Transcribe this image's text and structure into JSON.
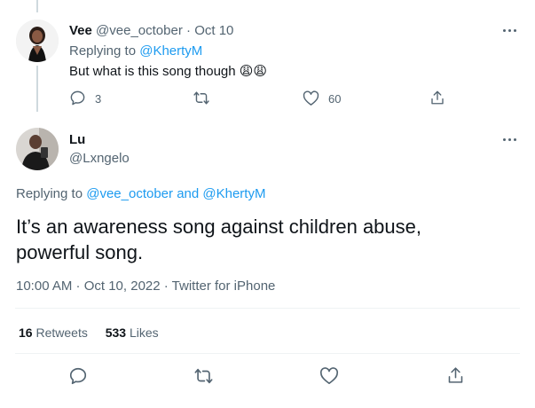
{
  "reply": {
    "display_name": "Vee",
    "handle": "@vee_october",
    "separator": "·",
    "date": "Oct 10",
    "replying_prefix": "Replying to",
    "replying_to": "@KhertyM",
    "text": "But what is this song though",
    "emoji": "😩😩",
    "reply_count": "3",
    "like_count": "60",
    "icons": [
      "reply-icon",
      "retweet-icon",
      "like-icon",
      "share-icon"
    ]
  },
  "main": {
    "display_name": "Lu",
    "handle": "@Lxngelo",
    "replying_prefix": "Replying to",
    "replying_to_1": "@vee_october",
    "and": "and",
    "replying_to_2": "@KhertyM",
    "text_line1": "It’s an awareness song against children abuse,",
    "text_line2": "powerful song.",
    "meta": "10:00 AM · Oct 10, 2022 · Twitter for iPhone",
    "retweets_count": "16",
    "retweets_label": "Retweets",
    "likes_count": "533",
    "likes_label": "Likes",
    "icons": [
      "reply-icon",
      "retweet-icon",
      "like-icon",
      "share-icon"
    ]
  },
  "colors": {
    "link": "#1d9bf0",
    "muted": "#536471",
    "text": "#0f1419",
    "divider": "#eff3f4"
  }
}
